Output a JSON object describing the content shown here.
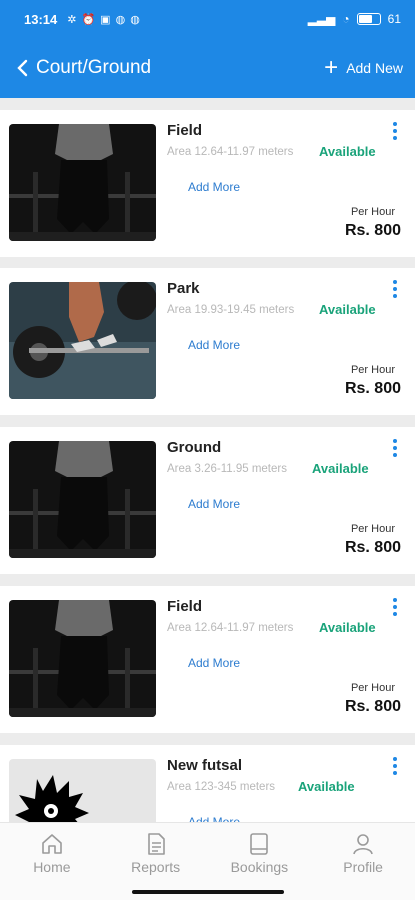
{
  "status_bar": {
    "time": "13:14",
    "battery": "61"
  },
  "header": {
    "title": "Court/Ground",
    "add_label": "Add New"
  },
  "items": [
    {
      "title": "Field",
      "area": "Area 12.64-11.97 meters",
      "status": "Available",
      "add_more": "Add More",
      "per_hour": "Per Hour",
      "price": "Rs. 800",
      "image": "gym-silhouette"
    },
    {
      "title": "Park",
      "area": "Area 19.93-19.45 meters",
      "status": "Available",
      "add_more": "Add More",
      "per_hour": "Per Hour",
      "price": "Rs. 800",
      "image": "deadlift-photo"
    },
    {
      "title": "Ground",
      "area": "Area 3.26-11.95 meters",
      "status": "Available",
      "add_more": "Add More",
      "per_hour": "Per Hour",
      "price": "Rs. 800",
      "image": "gym-silhouette"
    },
    {
      "title": "Field",
      "area": "Area 12.64-11.97 meters",
      "status": "Available",
      "add_more": "Add More",
      "per_hour": "Per Hour",
      "price": "Rs. 800",
      "image": "gym-silhouette"
    },
    {
      "title": "New futsal",
      "area": "Area 123-345 meters",
      "status": "Available",
      "add_more": "Add More",
      "per_hour": "",
      "price": "",
      "image": "cartoon-placeholder"
    }
  ],
  "nav": [
    {
      "label": "Home",
      "icon": "home-icon"
    },
    {
      "label": "Reports",
      "icon": "document-icon"
    },
    {
      "label": "Bookings",
      "icon": "book-icon"
    },
    {
      "label": "Profile",
      "icon": "person-icon"
    }
  ],
  "colors": {
    "primary": "#1e88e5",
    "available": "#1aa37a",
    "link": "#2d7ccf",
    "nav_inactive": "#9a9a9a"
  }
}
